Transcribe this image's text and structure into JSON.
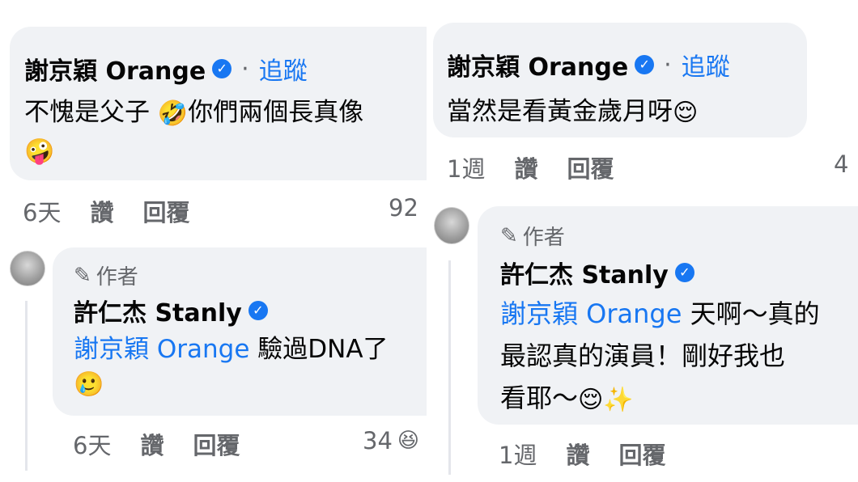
{
  "left": {
    "comment": {
      "author": "謝京穎 Orange",
      "separator": "·",
      "follow": "追蹤",
      "text_line1": "不愧是父子 ",
      "text_line1_after": "你們兩個長真像",
      "emoji_laugh": "🤣",
      "emoji_zany": "🤪",
      "time": "6天",
      "like": "讚",
      "reply": "回覆",
      "reaction_count": "92"
    },
    "reply": {
      "author_tag": "作者",
      "author": "許仁杰 Stanly",
      "mention": "謝京穎 Orange",
      "text": " 驗過DNA了",
      "emoji_sad": "🥲",
      "time": "6天",
      "like": "讚",
      "reply": "回覆",
      "reaction_count": "34",
      "reaction_emoji": "😆"
    }
  },
  "right": {
    "comment": {
      "author": "謝京穎 Orange",
      "separator": "·",
      "follow": "追蹤",
      "text": "當然是看黃金歲月呀",
      "emoji_relieved": "😌",
      "time": "1週",
      "like": "讚",
      "reply": "回覆",
      "reaction_count_partial": "4"
    },
    "reply": {
      "author_tag": "作者",
      "author": "許仁杰 Stanly",
      "mention": "謝京穎 Orange",
      "text_line1": " 天啊～真的",
      "text_line2": "最認真的演員！剛好我也",
      "text_line3": "看耶～",
      "emoji_relieved": "😌",
      "emoji_sparkles": "✨",
      "time": "1週",
      "like": "讚",
      "reply": "回覆"
    }
  },
  "colors": {
    "link": "#1877f2",
    "bubble": "#f0f2f5",
    "meta": "#65676b",
    "text": "#050505"
  },
  "icons": {
    "verified": "verified-badge-icon",
    "pencil": "pencil-icon"
  }
}
